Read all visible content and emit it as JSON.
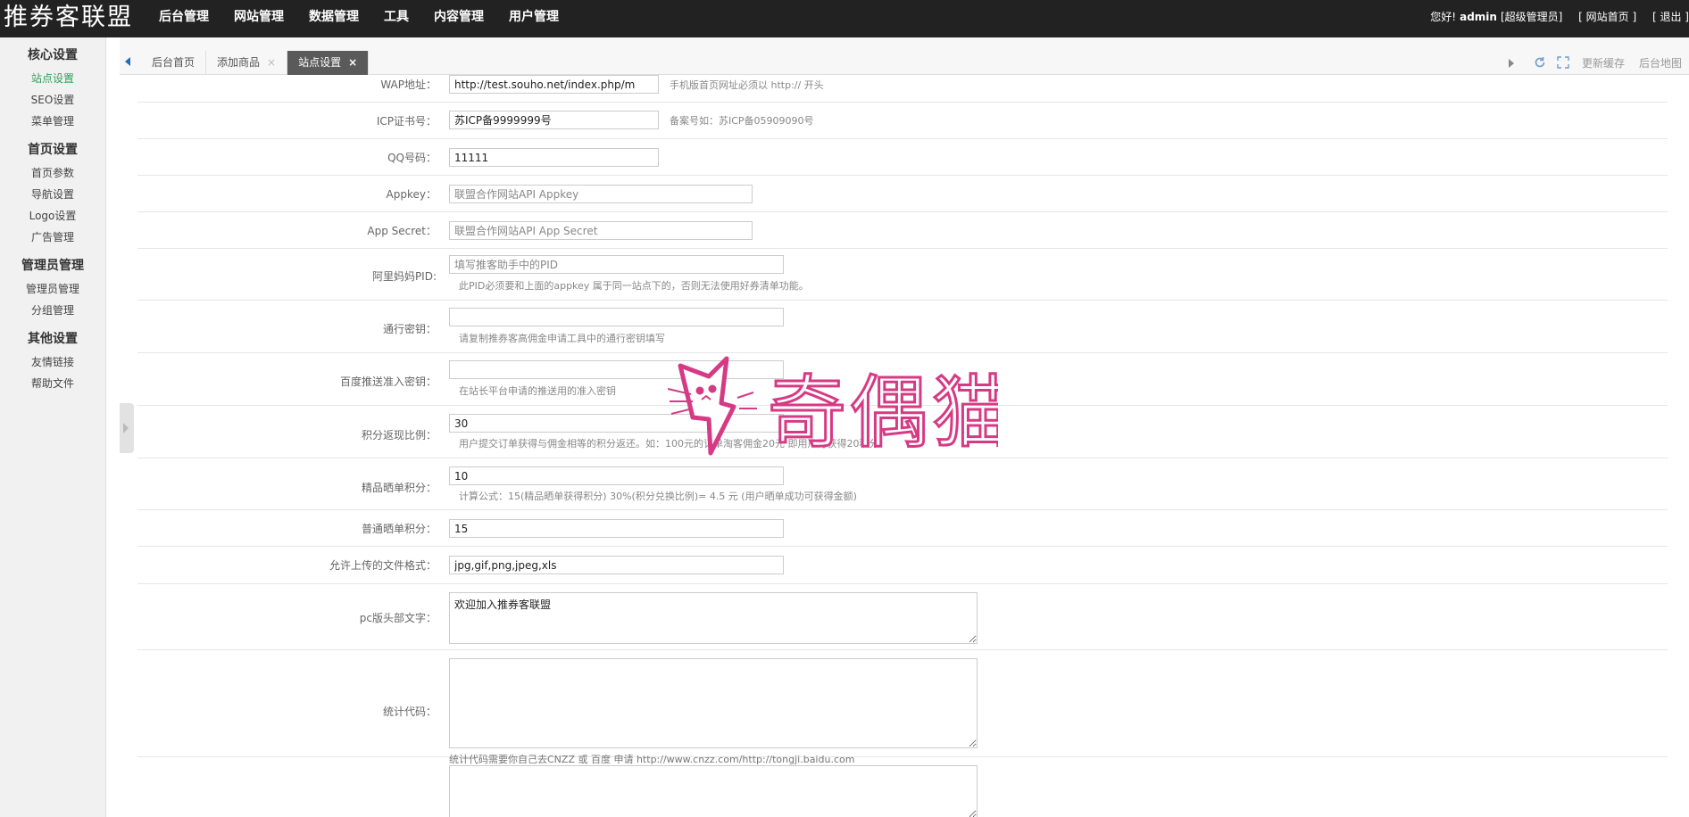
{
  "header": {
    "logo": "推券客联盟",
    "nav": [
      "后台管理",
      "网站管理",
      "数据管理",
      "工具",
      "内容管理",
      "用户管理"
    ],
    "greeting": "您好!",
    "username": "admin",
    "role": "[超级管理员]",
    "site_home": "[ 网站首页 ]",
    "logout": "[ 退出 ]"
  },
  "sidebar": {
    "groups": [
      {
        "title": "核心设置",
        "items": [
          "站点设置",
          "SEO设置",
          "菜单管理"
        ]
      },
      {
        "title": "首页设置",
        "items": [
          "首页参数",
          "导航设置",
          "Logo设置",
          "广告管理"
        ]
      },
      {
        "title": "管理员管理",
        "items": [
          "管理员管理",
          "分组管理"
        ]
      },
      {
        "title": "其他设置",
        "items": [
          "友情链接",
          "帮助文件"
        ]
      }
    ],
    "active_item": "站点设置"
  },
  "tabs": {
    "items": [
      {
        "label": "后台首页",
        "close": ""
      },
      {
        "label": "添加商品",
        "close": "×"
      },
      {
        "label": "站点设置",
        "close": "×"
      }
    ],
    "refresh_icon": "refresh-icon",
    "fullscreen_icon": "fullscreen-icon",
    "update_cache": "更新缓存",
    "site_map": "后台地图"
  },
  "form": {
    "wap": {
      "label": "WAP地址：",
      "value": "http://test.souho.net/index.php/m",
      "hint": "手机版首页网址必须以 http:// 开头"
    },
    "icp": {
      "label": "ICP证书号：",
      "value": "苏ICP备9999999号",
      "hint": "备案号如：苏ICP备05909090号"
    },
    "qq": {
      "label": "QQ号码：",
      "value": "11111"
    },
    "appkey": {
      "label": "Appkey：",
      "placeholder": "联盟合作网站API Appkey"
    },
    "appsecret": {
      "label": "App Secret：",
      "placeholder": "联盟合作网站API App Secret"
    },
    "pid": {
      "label": "阿里妈妈PID:",
      "placeholder": "填写推客助手中的PID",
      "hint": "此PID必须要和上面的appkey 属于同一站点下的，否则无法使用好券清单功能。"
    },
    "tongxing": {
      "label": "通行密钥：",
      "value": "",
      "hint": "请复制推券客高佣金申请工具中的通行密钥填写"
    },
    "baidu": {
      "label": "百度推送准入密钥：",
      "value": "",
      "hint": "在站长平台申请的推送用的准入密钥"
    },
    "ratio": {
      "label": "积分返现比例：",
      "value": "30",
      "hint": "用户提交订单获得与佣金相等的积分返还。如：100元的订单淘客佣金20元 即用户可获得20积分"
    },
    "jingpin": {
      "label": "精品晒单积分：",
      "value": "10",
      "hint": "计算公式：15(精品晒单获得积分) 30%(积分兑换比例)= 4.5 元 (用户晒单成功可获得金额)"
    },
    "putong": {
      "label": "普通晒单积分：",
      "value": "15"
    },
    "filetypes": {
      "label": "允许上传的文件格式：",
      "value": "jpg,gif,png,jpeg,xls"
    },
    "pchead": {
      "label": "pc版头部文字：",
      "value": "欢迎加入推券客联盟"
    },
    "stats": {
      "label": "统计代码：",
      "value": "",
      "hint": "统计代码需要你自己去CNZZ 或 百度 申请 http://www.cnzz.com/http://tongji.baidu.com"
    }
  },
  "watermark": {
    "text": "奇偶猫",
    "color": "#d63a84"
  }
}
